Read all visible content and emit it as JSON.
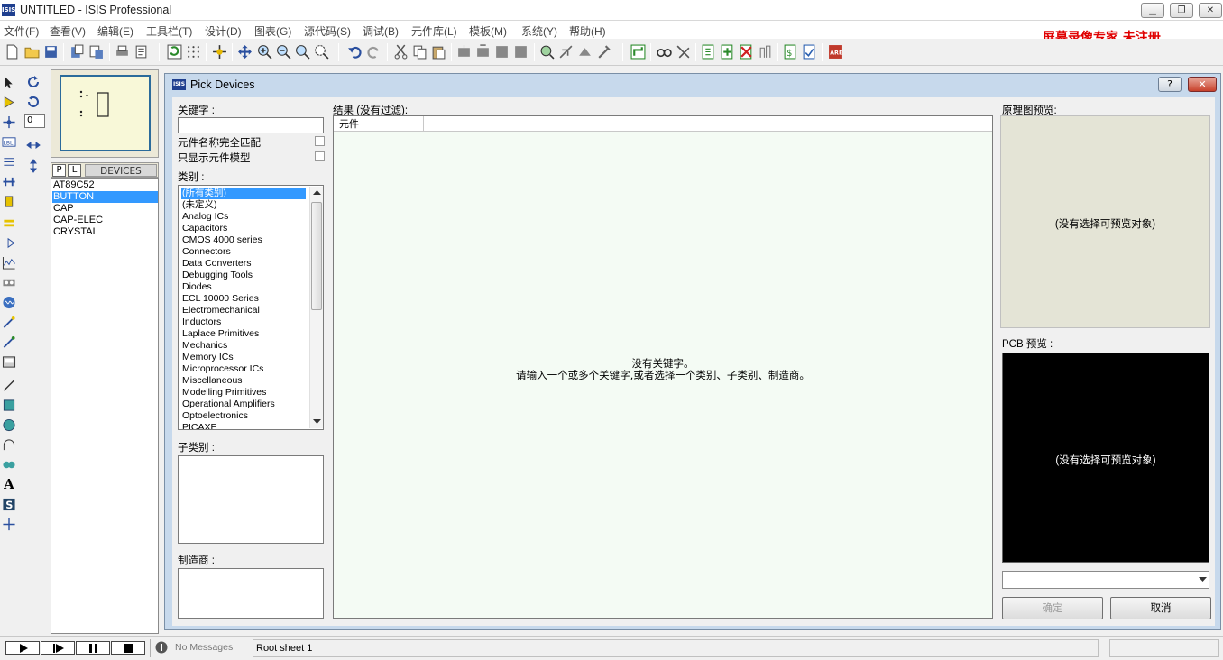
{
  "window": {
    "title": "UNTITLED - ISIS Professional",
    "icon_text": "ISIS",
    "min": "▁",
    "max": "❐",
    "close": "✕"
  },
  "menu": [
    "文件(F)",
    "查看(V)",
    "编辑(E)",
    "工具栏(T)",
    "设计(D)",
    "图表(G)",
    "源代码(S)",
    "调试(B)",
    "元件库(L)",
    "模板(M)",
    "系统(Y)",
    "帮助(H)"
  ],
  "watermark": "屏幕录像专家  未注册",
  "rotation_value": "0",
  "device_panel": {
    "tab_p": "P",
    "tab_l": "L",
    "title": "DEVICES",
    "selected_index": 1,
    "items": [
      "AT89C52",
      "BUTTON",
      "CAP",
      "CAP-ELEC",
      "CRYSTAL"
    ]
  },
  "dialog": {
    "title": "Pick Devices",
    "icon_text": "ISIS",
    "help": "?",
    "close": "✕",
    "keyword_label": "关键字 :",
    "keyword_value": "",
    "match_whole_label": "元件名称完全匹配",
    "show_models_label": "只显示元件模型",
    "category_label": "类别 :",
    "categories": [
      "(所有类别)",
      "(未定义)",
      "Analog ICs",
      "Capacitors",
      "CMOS 4000 series",
      "Connectors",
      "Data Converters",
      "Debugging Tools",
      "Diodes",
      "ECL 10000 Series",
      "Electromechanical",
      "Inductors",
      "Laplace Primitives",
      "Mechanics",
      "Memory ICs",
      "Microprocessor ICs",
      "Miscellaneous",
      "Modelling Primitives",
      "Operational Amplifiers",
      "Optoelectronics",
      "PICAXE"
    ],
    "selected_category": 0,
    "subcategory_label": "子类别 :",
    "manufacturer_label": "制造商 :",
    "results_label": "结果 (没有过滤):",
    "results_column": "元件",
    "results_msg1": "没有关键字。",
    "results_msg2": "请输入一个或多个关键字,或者选择一个类别、子类别、制造商。",
    "sch_preview_label": "原理图预览:",
    "sch_preview_text": "(没有选择可预览对象)",
    "pcb_preview_label": "PCB 预览 :",
    "pcb_preview_text": "(没有选择可预览对象)",
    "ok_label": "确定",
    "cancel_label": "取消"
  },
  "status": {
    "messages": "No Messages",
    "sheet": "Root sheet 1"
  },
  "colors": {
    "selection": "#3399ff",
    "dialog_frame": "#c7d9ec",
    "watermark": "#e00000",
    "pcb_bg": "#000000"
  }
}
